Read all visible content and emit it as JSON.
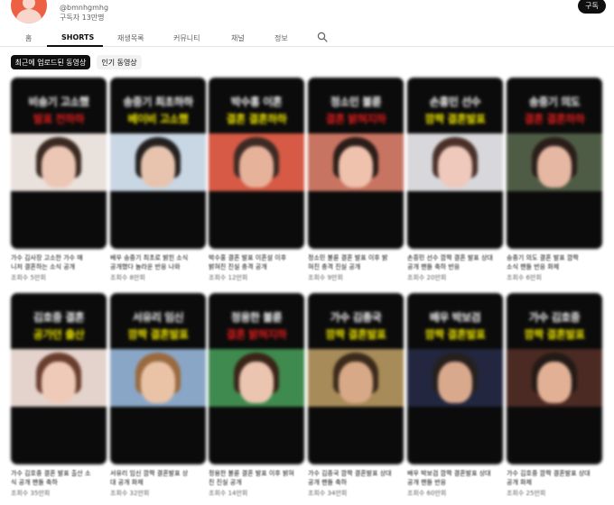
{
  "channel": {
    "handle": "@bmnhgmhg",
    "subscribers": "구독자 13만명",
    "subscribe_label": "구독"
  },
  "tabs": [
    {
      "label": "홈"
    },
    {
      "label": "SHORTS",
      "active": true
    },
    {
      "label": "재생목록"
    },
    {
      "label": "커뮤니티"
    },
    {
      "label": "채널"
    },
    {
      "label": "정보"
    }
  ],
  "icons": {
    "search": "search-icon",
    "avatar": "avatar-icon"
  },
  "filters": {
    "recent_label": "최근에 업로드된 동영상",
    "popular_label": "인기 동영상"
  },
  "colors": {
    "caption_red": "#e01c1c",
    "caption_yellow": "#f2e800",
    "avatar": "#ee6044"
  },
  "shorts": [
    {
      "caption_top": "비숑기 고소했",
      "caption_bottom": "발표 전하하",
      "accent": "red",
      "title_line1": "가수 김사장 고소한 가수 매",
      "title_line2": "니저 결혼하는 소식 공개",
      "views": "조회수 5만회"
    },
    {
      "caption_top": "송중기 최초하하",
      "caption_bottom": "베이비 고소했",
      "accent": "yellow",
      "title_line1": "배우 송중기 최초로 밝힌 소식",
      "title_line2": "공개했다 놀라운 반응 나와",
      "views": "조회수 8만회"
    },
    {
      "caption_top": "박수홍 이혼",
      "caption_bottom": "결혼 결혼하하",
      "accent": "yellow",
      "title_line1": "박수홍 결혼 발표 이혼설 이후",
      "title_line2": "밝혀진 진실 충격 공개",
      "views": "조회수 12만회"
    },
    {
      "caption_top": "정소민 불륜",
      "caption_bottom": "결혼 밝혀지하",
      "accent": "red",
      "title_line1": "정소민 불륜 결혼 발표 이후 밝",
      "title_line2": "혀진 충격 진실 공개",
      "views": "조회수 9만회"
    },
    {
      "caption_top": "손흥민 선수",
      "caption_bottom": "깜짝 결혼발표",
      "accent": "yellow",
      "title_line1": "손흥민 선수 깜짝 결혼 발표 상대",
      "title_line2": "공개 팬들 축하 반응",
      "views": "조회수 20만회"
    },
    {
      "caption_top": "송중기 의도",
      "caption_bottom": "결혼 결혼하하",
      "accent": "red",
      "title_line1": "송중기 의도 결혼 발표 깜짝",
      "title_line2": "소식 팬들 반응 화제",
      "views": "조회수 6만회"
    },
    {
      "caption_top": "김호중 결혼",
      "caption_bottom": "공가던 출산",
      "accent": "yellow",
      "title_line1": "가수 김호중 결혼 발표 출산 소",
      "title_line2": "식 공개 팬들 축하",
      "views": "조회수 35만회"
    },
    {
      "caption_top": "서유리 임신",
      "caption_bottom": "깜짝 결혼발표",
      "accent": "yellow",
      "title_line1": "서유리 임신 깜짝 결혼발표 상",
      "title_line2": "대 공개 화제",
      "views": "조회수 32만회"
    },
    {
      "caption_top": "정용한 불륜",
      "caption_bottom": "결혼 밝혀지하",
      "accent": "red",
      "title_line1": "정용한 불륜 결혼 발표 이후 밝혀",
      "title_line2": "진 진실 공개",
      "views": "조회수 14만회"
    },
    {
      "caption_top": "가수 김종국",
      "caption_bottom": "깜짝 결혼발표",
      "accent": "yellow",
      "title_line1": "가수 김종국 깜짝 결혼발표 상대",
      "title_line2": "공개 팬들 축하",
      "views": "조회수 34만회"
    },
    {
      "caption_top": "배우 박보검",
      "caption_bottom": "깜짝 결혼발표",
      "accent": "yellow",
      "title_line1": "배우 박보검 깜짝 결혼발표 상대",
      "title_line2": "공개 팬들 반응",
      "views": "조회수 60만회"
    },
    {
      "caption_top": "가수 김호중",
      "caption_bottom": "깜짝 결혼발표",
      "accent": "yellow",
      "title_line1": "가수 김호중 깜짝 결혼발표 상대",
      "title_line2": "공개 화제",
      "views": "조회수 25만회"
    }
  ]
}
